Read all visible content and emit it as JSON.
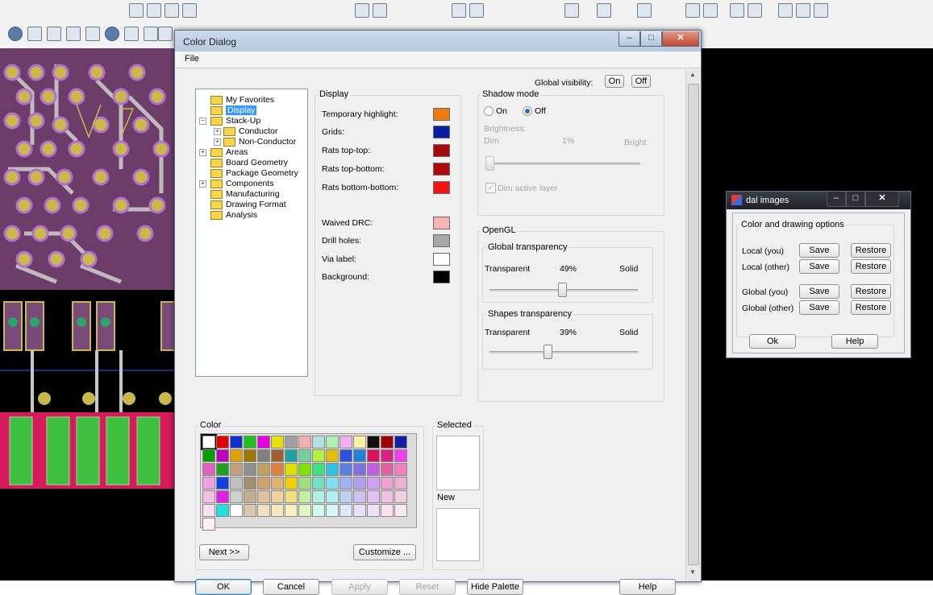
{
  "dialog": {
    "title": "Color Dialog",
    "menu_file": "File",
    "global_visibility_label": "Global visibility:",
    "global_on": "On",
    "global_off": "Off"
  },
  "tree": {
    "items": [
      {
        "label": "My Favorites"
      },
      {
        "label": "Display",
        "selected": true
      },
      {
        "label": "Stack-Up"
      },
      {
        "label": "Conductor"
      },
      {
        "label": "Non-Conductor"
      },
      {
        "label": "Areas"
      },
      {
        "label": "Board Geometry"
      },
      {
        "label": "Package Geometry"
      },
      {
        "label": "Components"
      },
      {
        "label": "Manufacturing"
      },
      {
        "label": "Drawing Format"
      },
      {
        "label": "Analysis"
      }
    ]
  },
  "display": {
    "group_title": "Display",
    "rows": [
      {
        "label": "Temporary highlight:",
        "color": "#f07a12"
      },
      {
        "label": "Grids:",
        "color": "#0a1ea0"
      },
      {
        "label": "Rats top-top:",
        "color": "#a60a0a"
      },
      {
        "label": "Rats top-bottom:",
        "color": "#ae0a0a"
      },
      {
        "label": "Rats bottom-bottom:",
        "color": "#f41414"
      },
      {
        "label": "Waived DRC:",
        "color": "#f6b4b4"
      },
      {
        "label": "Drill holes:",
        "color": "#a8a8a8"
      },
      {
        "label": "Via label:",
        "color": "#ffffff"
      },
      {
        "label": "Background:",
        "color": "#000000"
      }
    ]
  },
  "shadow": {
    "group_title": "Shadow mode",
    "on_label": "On",
    "off_label": "Off",
    "selected": "Off",
    "brightness_label": "Brightness:",
    "dim_label": "Dim",
    "percent": "1%",
    "bright_label": "Bright",
    "dim_active_layer_label": "Dim active layer",
    "dim_active_layer_checked": true
  },
  "opengl": {
    "group_title": "OpenGL",
    "global": {
      "title": "Global transparency",
      "left_label": "Transparent",
      "percent": "49%",
      "right_label": "Solid",
      "level": 0.49
    },
    "shapes": {
      "title": "Shapes transparency",
      "left_label": "Transparent",
      "percent": "39%",
      "right_label": "Solid",
      "level": 0.39
    }
  },
  "color_section": {
    "group_title": "Color",
    "next_label": "Next >>",
    "customize_label": "Customize ...",
    "selected_title": "Selected",
    "new_title": "New",
    "palette": [
      "#ffffff",
      "#e00000",
      "#1030d0",
      "#20c020",
      "#e000e0",
      "#e8e000",
      "#a0a0a0",
      "#f4b0b0",
      "#b0e0e0",
      "#b0f0b0",
      "#f0b0f0",
      "#f8f0a0",
      "#101010",
      "#a00000",
      "#1020a0",
      "#00a000",
      "#c000c0",
      "#e0a000",
      "#a07800",
      "#808080",
      "#a06030",
      "#20a0a0",
      "#70d0a0",
      "#b0f040",
      "#e0c000",
      "#3050e0",
      "#2080e0",
      "#e01060",
      "#e02080",
      "#f040f0",
      "#e060c0",
      "#20a020",
      "#c0a080",
      "#909090",
      "#c0a060",
      "#e08040",
      "#e0e000",
      "#80e000",
      "#40e080",
      "#30c0e0",
      "#6080e0",
      "#8070e0",
      "#c060e0",
      "#e060a0",
      "#f080c0",
      "#f0a0e0",
      "#1040e0",
      "#c0c0c0",
      "#a09070",
      "#d0a070",
      "#e0b070",
      "#f0d000",
      "#a0e080",
      "#70e0c0",
      "#80e0f0",
      "#a0b0f0",
      "#b0a0f0",
      "#d0a0f0",
      "#f0a0d0",
      "#f0b0d0",
      "#f0c0e0",
      "#e020e0",
      "#d0d0d0",
      "#c0b090",
      "#e0c0a0",
      "#f0d0a0",
      "#f0e080",
      "#c0f0a0",
      "#b0f0e0",
      "#b0f0f0",
      "#c0d0f0",
      "#d0c0f0",
      "#e0c0f0",
      "#f0c0e0",
      "#f0d0e0",
      "#f8e0f0",
      "#20e0e0",
      "#ffffff",
      "#d8c8b0",
      "#f0e0c0",
      "#f8e8c0",
      "#f8f0c0",
      "#e0f8c0",
      "#d0f8f0",
      "#d8f8f8",
      "#e0e8f8",
      "#e8e0f8",
      "#f0e0f8",
      "#f8e0f0",
      "#f8e8f0",
      "#fff0f8"
    ]
  },
  "buttons": {
    "ok": "OK",
    "cancel": "Cancel",
    "apply": "Apply",
    "reset": "Reset",
    "hide_palette": "Hide Palette",
    "help": "Help"
  },
  "mini": {
    "title": "dal images",
    "group_title": "Color and drawing options",
    "rows": [
      {
        "label": "Local (you)",
        "save": "Save",
        "restore": "Restore"
      },
      {
        "label": "Local (other)",
        "save": "Save",
        "restore": "Restore"
      },
      {
        "label": "Global (you)",
        "save": "Save",
        "restore": "Restore"
      },
      {
        "label": "Global (other)",
        "save": "Save",
        "restore": "Restore"
      }
    ],
    "ok": "Ok",
    "help": "Help"
  }
}
